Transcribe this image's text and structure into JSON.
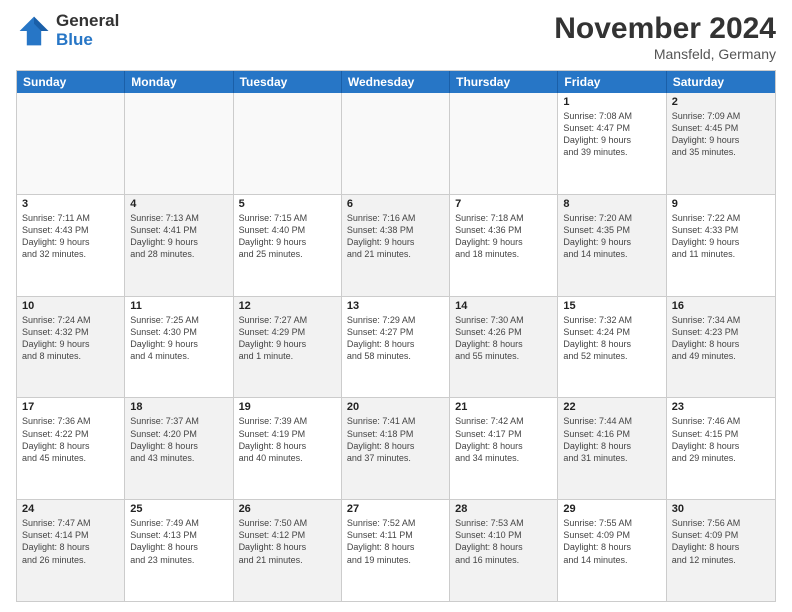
{
  "logo": {
    "general": "General",
    "blue": "Blue"
  },
  "title": {
    "month": "November 2024",
    "location": "Mansfeld, Germany"
  },
  "header_days": [
    "Sunday",
    "Monday",
    "Tuesday",
    "Wednesday",
    "Thursday",
    "Friday",
    "Saturday"
  ],
  "weeks": [
    [
      {
        "day": "",
        "info": "",
        "shaded": true,
        "empty": true
      },
      {
        "day": "",
        "info": "",
        "shaded": true,
        "empty": true
      },
      {
        "day": "",
        "info": "",
        "shaded": true,
        "empty": true
      },
      {
        "day": "",
        "info": "",
        "shaded": true,
        "empty": true
      },
      {
        "day": "",
        "info": "",
        "shaded": true,
        "empty": true
      },
      {
        "day": "1",
        "info": "Sunrise: 7:08 AM\nSunset: 4:47 PM\nDaylight: 9 hours\nand 39 minutes.",
        "shaded": false
      },
      {
        "day": "2",
        "info": "Sunrise: 7:09 AM\nSunset: 4:45 PM\nDaylight: 9 hours\nand 35 minutes.",
        "shaded": true
      }
    ],
    [
      {
        "day": "3",
        "info": "Sunrise: 7:11 AM\nSunset: 4:43 PM\nDaylight: 9 hours\nand 32 minutes.",
        "shaded": false
      },
      {
        "day": "4",
        "info": "Sunrise: 7:13 AM\nSunset: 4:41 PM\nDaylight: 9 hours\nand 28 minutes.",
        "shaded": true
      },
      {
        "day": "5",
        "info": "Sunrise: 7:15 AM\nSunset: 4:40 PM\nDaylight: 9 hours\nand 25 minutes.",
        "shaded": false
      },
      {
        "day": "6",
        "info": "Sunrise: 7:16 AM\nSunset: 4:38 PM\nDaylight: 9 hours\nand 21 minutes.",
        "shaded": true
      },
      {
        "day": "7",
        "info": "Sunrise: 7:18 AM\nSunset: 4:36 PM\nDaylight: 9 hours\nand 18 minutes.",
        "shaded": false
      },
      {
        "day": "8",
        "info": "Sunrise: 7:20 AM\nSunset: 4:35 PM\nDaylight: 9 hours\nand 14 minutes.",
        "shaded": true
      },
      {
        "day": "9",
        "info": "Sunrise: 7:22 AM\nSunset: 4:33 PM\nDaylight: 9 hours\nand 11 minutes.",
        "shaded": false
      }
    ],
    [
      {
        "day": "10",
        "info": "Sunrise: 7:24 AM\nSunset: 4:32 PM\nDaylight: 9 hours\nand 8 minutes.",
        "shaded": true
      },
      {
        "day": "11",
        "info": "Sunrise: 7:25 AM\nSunset: 4:30 PM\nDaylight: 9 hours\nand 4 minutes.",
        "shaded": false
      },
      {
        "day": "12",
        "info": "Sunrise: 7:27 AM\nSunset: 4:29 PM\nDaylight: 9 hours\nand 1 minute.",
        "shaded": true
      },
      {
        "day": "13",
        "info": "Sunrise: 7:29 AM\nSunset: 4:27 PM\nDaylight: 8 hours\nand 58 minutes.",
        "shaded": false
      },
      {
        "day": "14",
        "info": "Sunrise: 7:30 AM\nSunset: 4:26 PM\nDaylight: 8 hours\nand 55 minutes.",
        "shaded": true
      },
      {
        "day": "15",
        "info": "Sunrise: 7:32 AM\nSunset: 4:24 PM\nDaylight: 8 hours\nand 52 minutes.",
        "shaded": false
      },
      {
        "day": "16",
        "info": "Sunrise: 7:34 AM\nSunset: 4:23 PM\nDaylight: 8 hours\nand 49 minutes.",
        "shaded": true
      }
    ],
    [
      {
        "day": "17",
        "info": "Sunrise: 7:36 AM\nSunset: 4:22 PM\nDaylight: 8 hours\nand 45 minutes.",
        "shaded": false
      },
      {
        "day": "18",
        "info": "Sunrise: 7:37 AM\nSunset: 4:20 PM\nDaylight: 8 hours\nand 43 minutes.",
        "shaded": true
      },
      {
        "day": "19",
        "info": "Sunrise: 7:39 AM\nSunset: 4:19 PM\nDaylight: 8 hours\nand 40 minutes.",
        "shaded": false
      },
      {
        "day": "20",
        "info": "Sunrise: 7:41 AM\nSunset: 4:18 PM\nDaylight: 8 hours\nand 37 minutes.",
        "shaded": true
      },
      {
        "day": "21",
        "info": "Sunrise: 7:42 AM\nSunset: 4:17 PM\nDaylight: 8 hours\nand 34 minutes.",
        "shaded": false
      },
      {
        "day": "22",
        "info": "Sunrise: 7:44 AM\nSunset: 4:16 PM\nDaylight: 8 hours\nand 31 minutes.",
        "shaded": true
      },
      {
        "day": "23",
        "info": "Sunrise: 7:46 AM\nSunset: 4:15 PM\nDaylight: 8 hours\nand 29 minutes.",
        "shaded": false
      }
    ],
    [
      {
        "day": "24",
        "info": "Sunrise: 7:47 AM\nSunset: 4:14 PM\nDaylight: 8 hours\nand 26 minutes.",
        "shaded": true
      },
      {
        "day": "25",
        "info": "Sunrise: 7:49 AM\nSunset: 4:13 PM\nDaylight: 8 hours\nand 23 minutes.",
        "shaded": false
      },
      {
        "day": "26",
        "info": "Sunrise: 7:50 AM\nSunset: 4:12 PM\nDaylight: 8 hours\nand 21 minutes.",
        "shaded": true
      },
      {
        "day": "27",
        "info": "Sunrise: 7:52 AM\nSunset: 4:11 PM\nDaylight: 8 hours\nand 19 minutes.",
        "shaded": false
      },
      {
        "day": "28",
        "info": "Sunrise: 7:53 AM\nSunset: 4:10 PM\nDaylight: 8 hours\nand 16 minutes.",
        "shaded": true
      },
      {
        "day": "29",
        "info": "Sunrise: 7:55 AM\nSunset: 4:09 PM\nDaylight: 8 hours\nand 14 minutes.",
        "shaded": false
      },
      {
        "day": "30",
        "info": "Sunrise: 7:56 AM\nSunset: 4:09 PM\nDaylight: 8 hours\nand 12 minutes.",
        "shaded": true
      }
    ]
  ]
}
